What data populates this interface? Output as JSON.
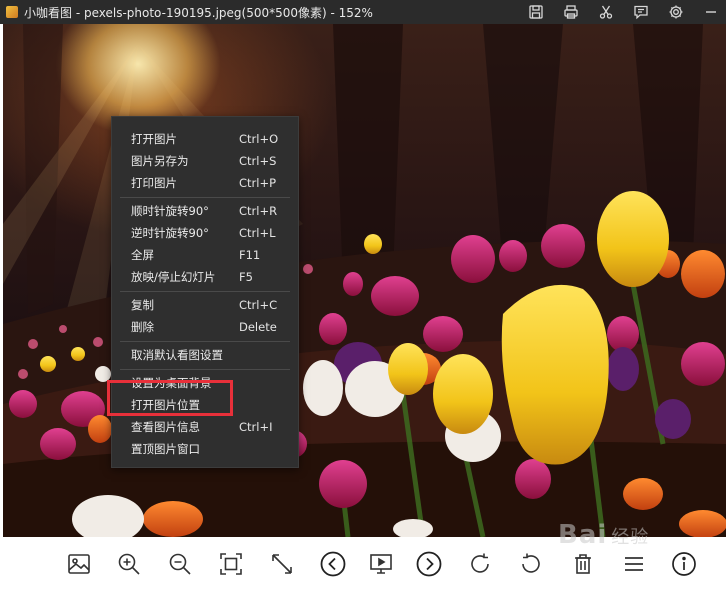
{
  "window": {
    "title": "小咖看图 - pexels-photo-190195.jpeg(500*500像素) - 152%"
  },
  "titlebar_icons": [
    "save-icon",
    "print-icon",
    "scissors-icon",
    "comment-icon",
    "gear-icon",
    "minimize-icon"
  ],
  "context_menu": {
    "items": [
      {
        "label": "打开图片",
        "shortcut": "Ctrl+O"
      },
      {
        "label": "图片另存为",
        "shortcut": "Ctrl+S"
      },
      {
        "label": "打印图片",
        "shortcut": "Ctrl+P"
      },
      {
        "label": "顺时针旋转90°",
        "shortcut": "Ctrl+R"
      },
      {
        "label": "逆时针旋转90°",
        "shortcut": "Ctrl+L"
      },
      {
        "label": "全屏",
        "shortcut": "F11"
      },
      {
        "label": "放映/停止幻灯片",
        "shortcut": "F5"
      },
      {
        "label": "复制",
        "shortcut": "Ctrl+C"
      },
      {
        "label": "删除",
        "shortcut": "Delete"
      },
      {
        "label": "取消默认看图设置",
        "shortcut": ""
      },
      {
        "label": "设置为桌面背景",
        "shortcut": ""
      },
      {
        "label": "打开图片位置",
        "shortcut": ""
      },
      {
        "label": "查看图片信息",
        "shortcut": "Ctrl+I"
      },
      {
        "label": "置顶图片窗口",
        "shortcut": ""
      }
    ],
    "highlighted_item": "打开图片位置"
  },
  "toolbar": {
    "buttons": [
      "image-icon",
      "zoom-in-icon",
      "zoom-out-icon",
      "fit-window-icon",
      "actual-size-icon",
      "previous-icon",
      "slideshow-icon",
      "next-icon",
      "rotate-clockwise-icon",
      "rotate-counterclockwise-icon",
      "delete-icon",
      "menu-icon",
      "info-icon"
    ]
  },
  "watermark": {
    "text": "Bai",
    "sub": "经验"
  },
  "colors": {
    "titlebar": "#2b2b2b",
    "menu_bg": "#2f2f2f",
    "highlight": "#e8303a",
    "tulip_yellow": "#f2c419",
    "tulip_magenta": "#c2185b"
  }
}
